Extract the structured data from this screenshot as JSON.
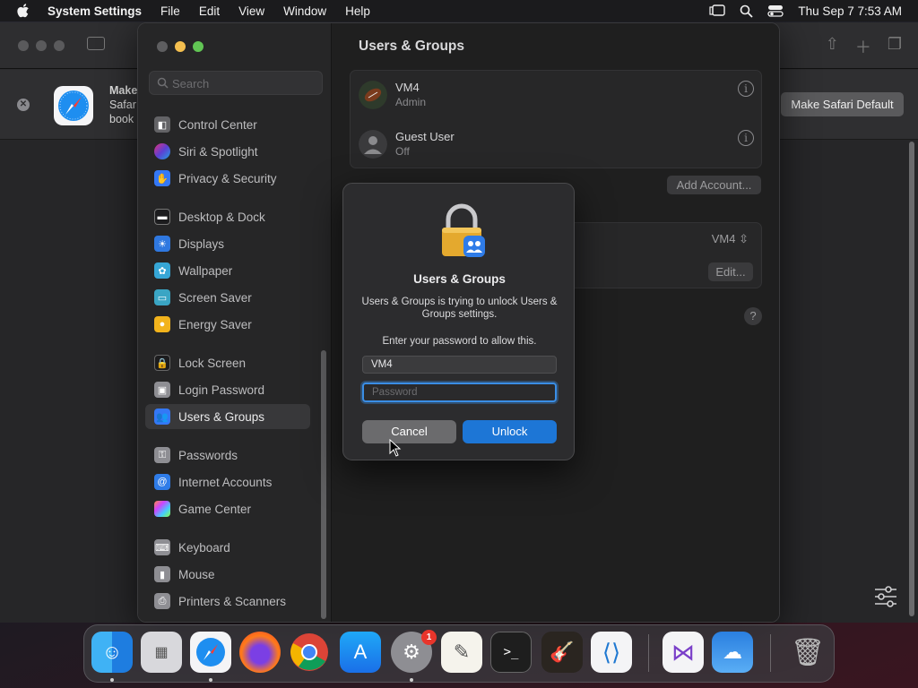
{
  "menubar": {
    "app_name": "System Settings",
    "menus": [
      "File",
      "Edit",
      "View",
      "Window",
      "Help"
    ],
    "clock": "Thu Sep 7  7:53 AM"
  },
  "safari": {
    "banner_title": "Make",
    "banner_line2": "Safar",
    "banner_line3": "book",
    "make_default_label": "Make Safari Default"
  },
  "sidebar": {
    "search_placeholder": "Search",
    "items": [
      {
        "label": "Control Center",
        "icon": "control-center-icon"
      },
      {
        "label": "Siri & Spotlight",
        "icon": "siri-icon"
      },
      {
        "label": "Privacy & Security",
        "icon": "hand-icon"
      },
      {
        "label": "Desktop & Dock",
        "icon": "desktop-icon"
      },
      {
        "label": "Displays",
        "icon": "sun-icon"
      },
      {
        "label": "Wallpaper",
        "icon": "flower-icon"
      },
      {
        "label": "Screen Saver",
        "icon": "screen-saver-icon"
      },
      {
        "label": "Energy Saver",
        "icon": "bulb-icon"
      },
      {
        "label": "Lock Screen",
        "icon": "lock-icon"
      },
      {
        "label": "Login Password",
        "icon": "login-lock-icon"
      },
      {
        "label": "Users & Groups",
        "icon": "users-icon"
      },
      {
        "label": "Passwords",
        "icon": "key-icon"
      },
      {
        "label": "Internet Accounts",
        "icon": "at-icon"
      },
      {
        "label": "Game Center",
        "icon": "game-center-icon"
      },
      {
        "label": "Keyboard",
        "icon": "keyboard-icon"
      },
      {
        "label": "Mouse",
        "icon": "mouse-icon"
      },
      {
        "label": "Printers & Scanners",
        "icon": "printer-icon"
      }
    ],
    "selected": "Users & Groups"
  },
  "main": {
    "title": "Users & Groups",
    "users": [
      {
        "name": "VM4",
        "role": "Admin"
      },
      {
        "name": "Guest User",
        "role": "Off"
      }
    ],
    "add_account_label": "Add Account...",
    "auto_login_value": "VM4",
    "edit_label": "Edit...",
    "help_label": "?"
  },
  "dialog": {
    "title": "Users & Groups",
    "message": "Users & Groups is trying to unlock Users & Groups settings.",
    "prompt": "Enter your password to allow this.",
    "username_value": "VM4",
    "password_placeholder": "Password",
    "cancel_label": "Cancel",
    "unlock_label": "Unlock"
  },
  "dock": {
    "apps": [
      "Finder",
      "Launchpad",
      "Safari",
      "Firefox",
      "Chrome",
      "App Store",
      "System Settings",
      "TextEdit",
      "Terminal",
      "GarageBand",
      "VS Code",
      "Visual Studio",
      "Weather",
      "Trash"
    ],
    "system_settings_badge": "1"
  }
}
